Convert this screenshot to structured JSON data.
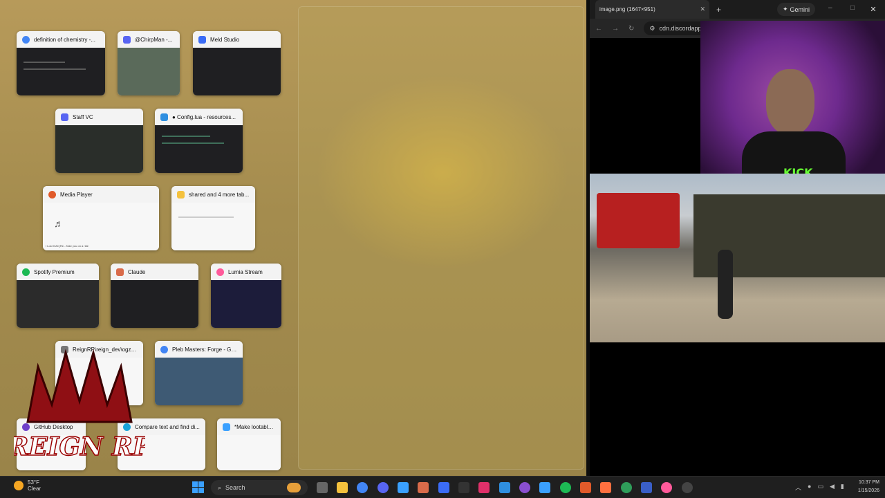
{
  "snap_assist": {
    "thumbnails": [
      {
        "title": "definition of chemistry -...",
        "icon": "chrome-icon",
        "color": "#4285f4"
      },
      {
        "title": "@ChirpMan -...",
        "icon": "discord-icon",
        "color": "#5865f2"
      },
      {
        "title": "Meld Studio",
        "icon": "meld-icon",
        "color": "#3b6cf6"
      },
      {
        "title": "Staff VC",
        "icon": "discord-icon",
        "color": "#5865f2"
      },
      {
        "title": "● Config.lua - resources...",
        "icon": "vscode-icon",
        "color": "#2f8fe0"
      },
      {
        "title": "Media Player",
        "icon": "media-player-icon",
        "color": "#e05a2a"
      },
      {
        "title": "shared and 4 more tab...",
        "icon": "folder-icon",
        "color": "#f4c13d"
      },
      {
        "title": "Spotify Premium",
        "icon": "spotify-icon",
        "color": "#1db954"
      },
      {
        "title": "Claude",
        "icon": "claude-icon",
        "color": "#d96b4a"
      },
      {
        "title": "Lumia Stream",
        "icon": "lumia-icon",
        "color": "#ff5a9a"
      },
      {
        "title": "ReignRP\\reign_dev\\ogz_...",
        "icon": "terminal-icon",
        "color": "#777777"
      },
      {
        "title": "Pleb Masters: Forge - GT...",
        "icon": "chrome-icon",
        "color": "#4285f4"
      },
      {
        "title": "GitHub Desktop",
        "icon": "github-icon",
        "color": "#6e40c9"
      },
      {
        "title": "Compare text and find di...",
        "icon": "edge-icon",
        "color": "#1aa3d9"
      },
      {
        "title": "*Make lootable...",
        "icon": "notepad-icon",
        "color": "#3aa0ff"
      }
    ],
    "media_player_caption": "I Lost It All (Re...Take you on a ride"
  },
  "browser": {
    "tab_title": "image.png (1647×951)",
    "tab_close": "✕",
    "new_tab": "+",
    "gemini_label": "Gemini",
    "url": "cdn.discordapp.c...",
    "close_glyph": "✕",
    "overlay_text": "KICK"
  },
  "logo_text": "REIGN RP",
  "taskbar": {
    "weather_temp": "53°F",
    "weather_desc": "Clear",
    "search_placeholder": "Search",
    "time": "10:37 PM",
    "date": "1/15/2026"
  }
}
